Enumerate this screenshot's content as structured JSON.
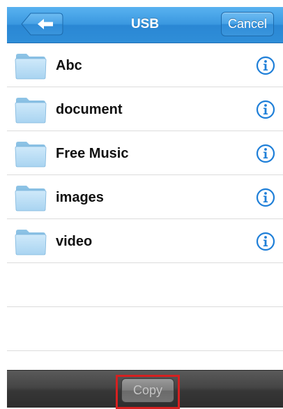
{
  "header": {
    "title": "USB",
    "back_icon": "back-arrow-icon",
    "cancel_label": "Cancel",
    "accent_color": "#3a98e0"
  },
  "files": [
    {
      "name": "Abc",
      "icon": "folder-icon",
      "action_icon": "info-icon"
    },
    {
      "name": "document",
      "icon": "folder-icon",
      "action_icon": "info-icon"
    },
    {
      "name": "Free Music",
      "icon": "folder-icon",
      "action_icon": "info-icon"
    },
    {
      "name": "images",
      "icon": "folder-icon",
      "action_icon": "info-icon"
    },
    {
      "name": "video",
      "icon": "folder-icon",
      "action_icon": "info-icon"
    }
  ],
  "toolbar": {
    "copy_label": "Copy",
    "copy_enabled": false,
    "highlight_color": "#d62020"
  }
}
